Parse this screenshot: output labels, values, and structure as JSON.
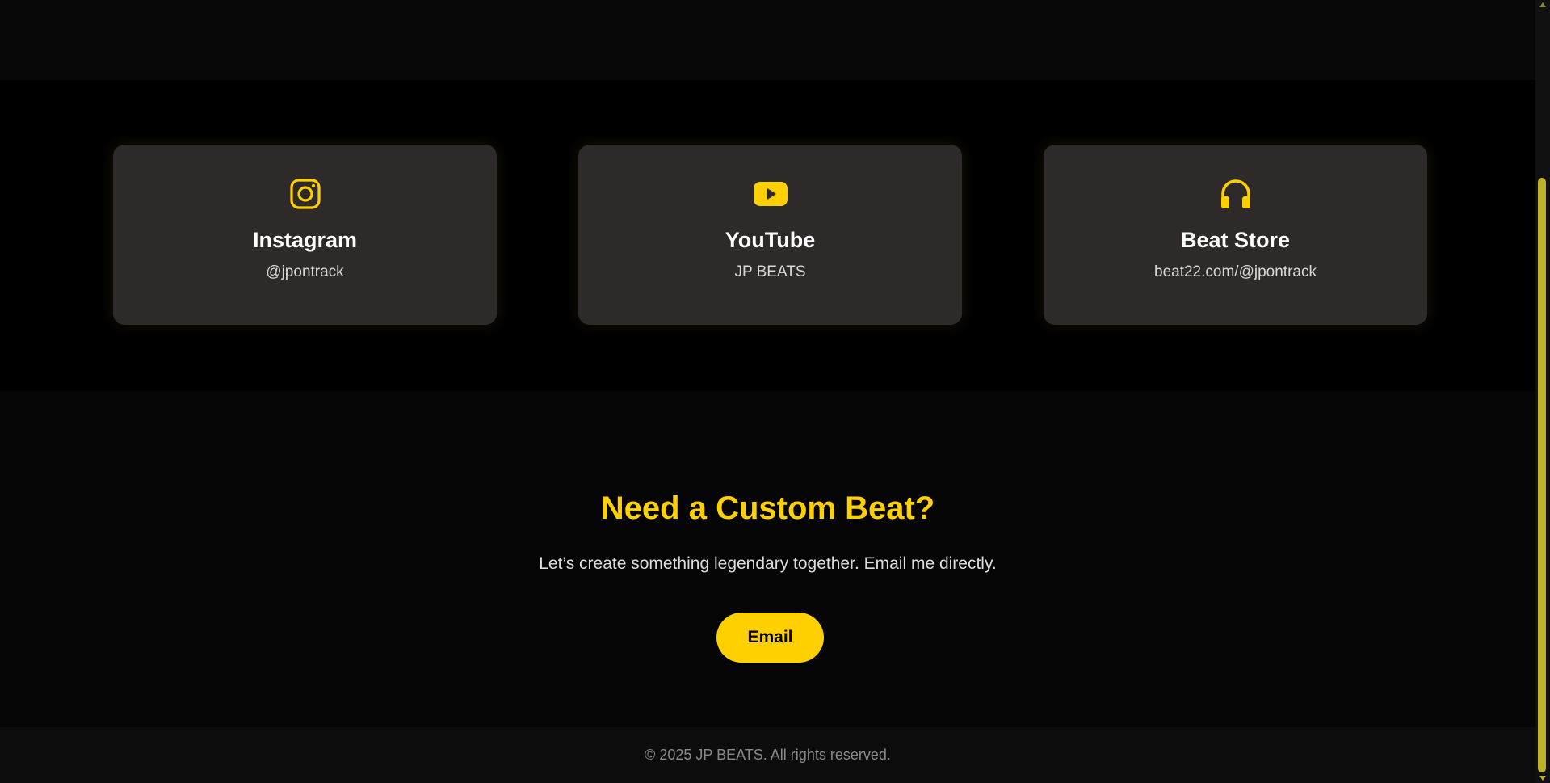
{
  "colors": {
    "accent": "#ffd000",
    "card_bg": "#2e2a29",
    "page_bg": "#000000",
    "footer_text": "#8a8a8a"
  },
  "social": {
    "cards": [
      {
        "icon": "instagram-icon",
        "title": "Instagram",
        "handle": "@jpontrack"
      },
      {
        "icon": "youtube-icon",
        "title": "YouTube",
        "handle": "JP BEATS"
      },
      {
        "icon": "headphones-icon",
        "title": "Beat Store",
        "handle": "beat22.com/@jpontrack"
      }
    ]
  },
  "cta": {
    "title": "Need a Custom Beat?",
    "subtitle": "Let’s create something legendary together. Email me directly.",
    "button_label": "Email"
  },
  "footer": {
    "copyright": "© 2025 JP BEATS. All rights reserved."
  }
}
